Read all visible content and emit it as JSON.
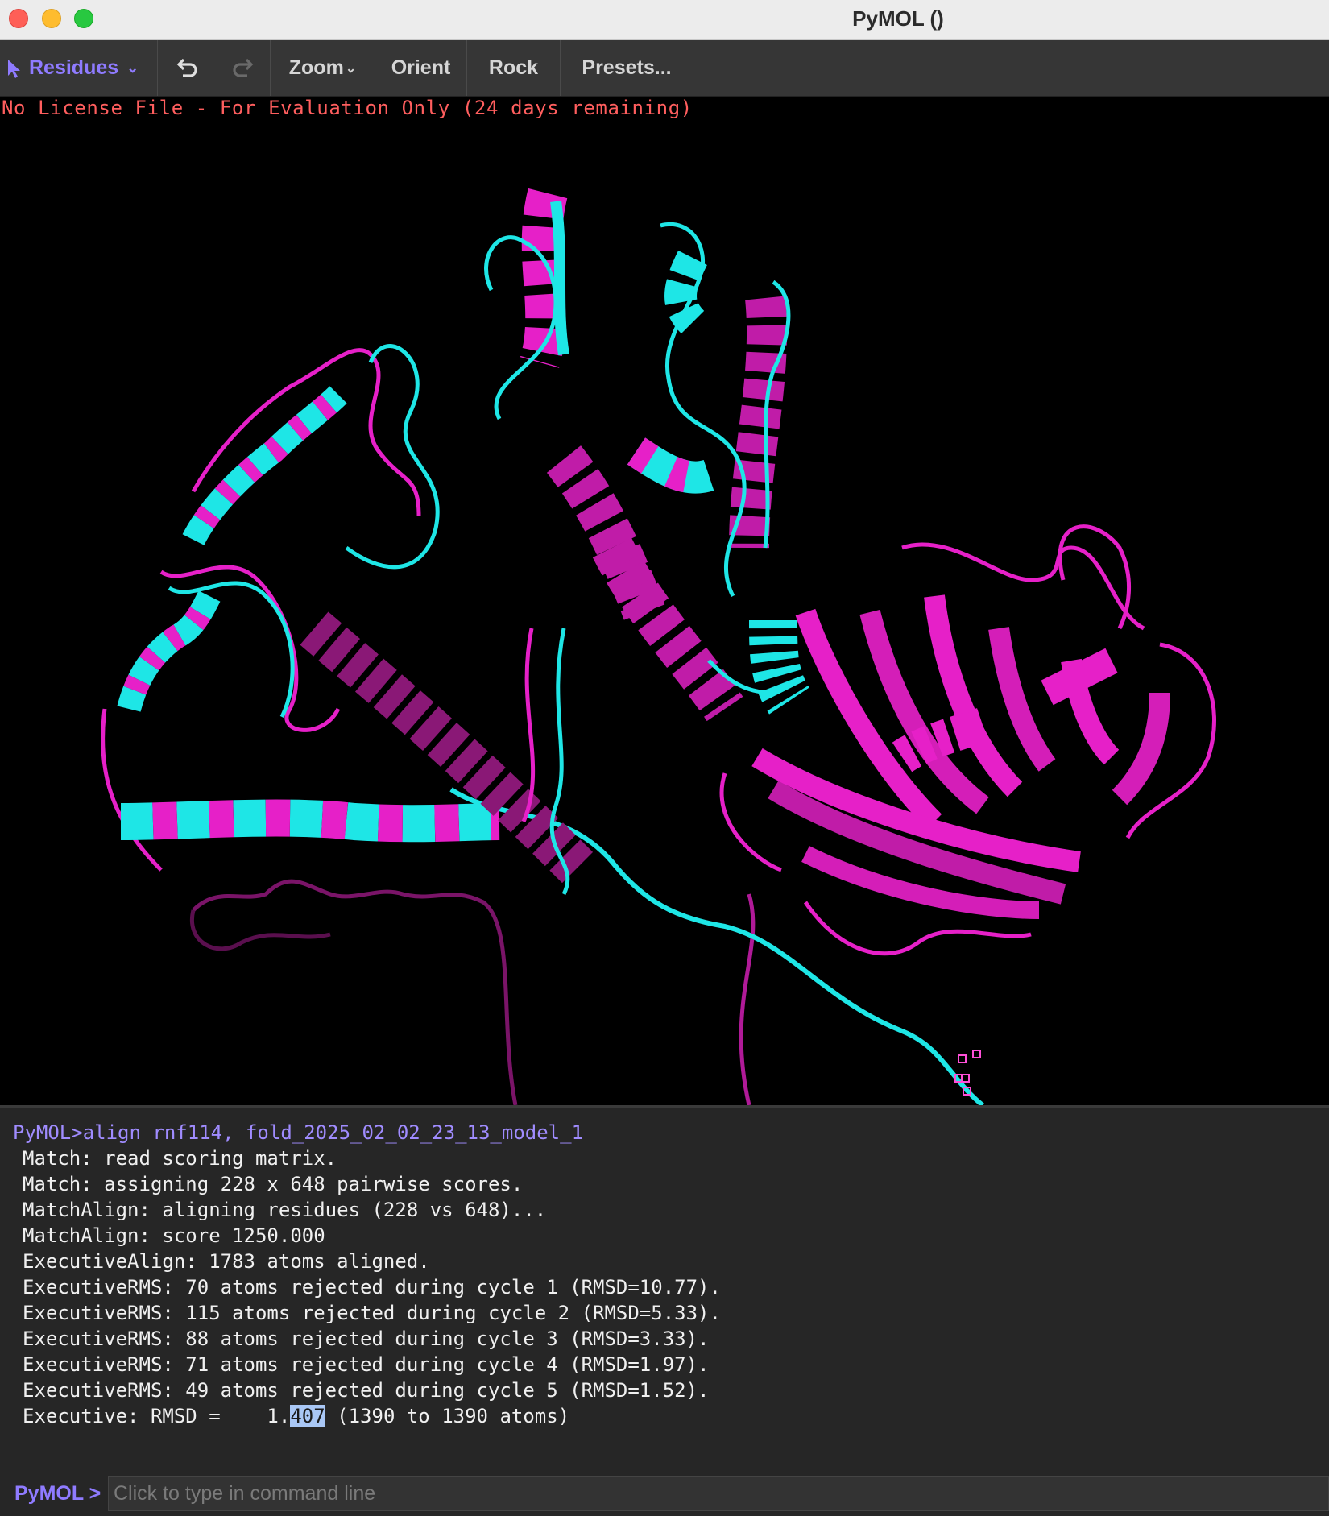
{
  "window": {
    "title": "PyMOL ()"
  },
  "toolbar": {
    "mode_label": "Residues",
    "zoom_label": "Zoom",
    "orient_label": "Orient",
    "rock_label": "Rock",
    "presets_label": "Presets..."
  },
  "viewer": {
    "license_text": "No License File - For Evaluation Only (24 days remaining)",
    "colors": {
      "model_a": "#e620c8",
      "model_b": "#1ee6e6",
      "background": "#000000"
    }
  },
  "console": {
    "command": "PyMOL>align rnf114, fold_2025_02_02_23_13_model_1",
    "lines": [
      "Match: read scoring matrix.",
      "Match: assigning 228 x 648 pairwise scores.",
      "MatchAlign: aligning residues (228 vs 648)...",
      "MatchAlign: score 1250.000",
      "ExecutiveAlign: 1783 atoms aligned.",
      "ExecutiveRMS: 70 atoms rejected during cycle 1 (RMSD=10.77).",
      "ExecutiveRMS: 115 atoms rejected during cycle 2 (RMSD=5.33).",
      "ExecutiveRMS: 88 atoms rejected during cycle 3 (RMSD=3.33).",
      "ExecutiveRMS: 71 atoms rejected during cycle 4 (RMSD=1.97).",
      "ExecutiveRMS: 49 atoms rejected during cycle 5 (RMSD=1.52)."
    ],
    "rmsd_prefix": "Executive: RMSD =    1.",
    "rmsd_selected": "407",
    "rmsd_suffix": " (1390 to 1390 atoms)"
  },
  "command_line": {
    "prompt": "PyMOL >",
    "placeholder": "Click to type in command line"
  }
}
